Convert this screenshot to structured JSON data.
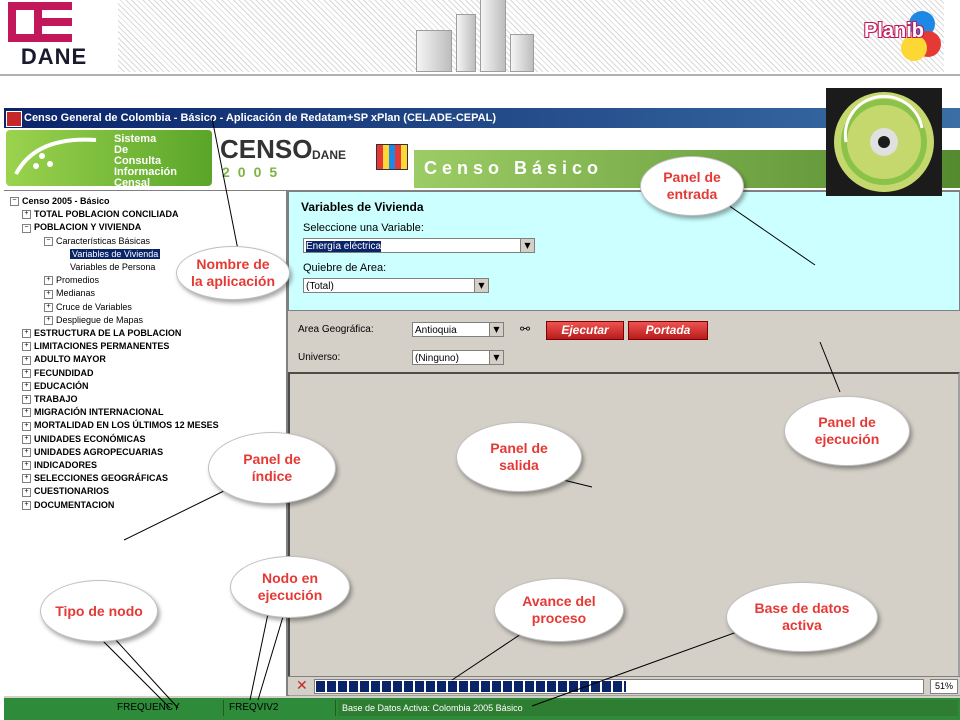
{
  "slide": {
    "dane_logo_text": "DANE",
    "planib_text": "Planib"
  },
  "app": {
    "window_title": "Censo General de Colombia - Básico - Aplicación de Redatam+SP xPlan (CELADE-CEPAL)",
    "banner": {
      "sistema_lines": "Sistema\nDe\nConsulta\nInformación\nCensal",
      "censo_text": "CENSO",
      "censo_year": "2005",
      "dane_text": "DANE",
      "censo_basico": "Censo Básico"
    },
    "tree": {
      "items": [
        {
          "label": "Censo 2005 - Básico",
          "level": 0,
          "expander": "−",
          "bold": true
        },
        {
          "label": "TOTAL POBLACION CONCILIADA",
          "level": 1,
          "expander": "+",
          "bold": true
        },
        {
          "label": "POBLACION Y VIVIENDA",
          "level": 1,
          "expander": "−",
          "bold": true
        },
        {
          "label": "Características Básicas",
          "level": 2,
          "expander": "−",
          "bold": false
        },
        {
          "label": "Variables de Vivienda",
          "level": 3,
          "expander": "",
          "bold": false,
          "selected": true
        },
        {
          "label": "Variables de Persona",
          "level": 3,
          "expander": "",
          "bold": false
        },
        {
          "label": "Promedios",
          "level": 2,
          "expander": "+",
          "bold": false
        },
        {
          "label": "Medianas",
          "level": 2,
          "expander": "+",
          "bold": false
        },
        {
          "label": "Cruce de Variables",
          "level": 2,
          "expander": "+",
          "bold": false
        },
        {
          "label": "Despliegue de Mapas",
          "level": 2,
          "expander": "+",
          "bold": false
        },
        {
          "label": "ESTRUCTURA DE LA POBLACION",
          "level": 1,
          "expander": "+",
          "bold": true
        },
        {
          "label": "LIMITACIONES PERMANENTES",
          "level": 1,
          "expander": "+",
          "bold": true
        },
        {
          "label": "ADULTO MAYOR",
          "level": 1,
          "expander": "+",
          "bold": true
        },
        {
          "label": "FECUNDIDAD",
          "level": 1,
          "expander": "+",
          "bold": true
        },
        {
          "label": "EDUCACIÓN",
          "level": 1,
          "expander": "+",
          "bold": true
        },
        {
          "label": "TRABAJO",
          "level": 1,
          "expander": "+",
          "bold": true
        },
        {
          "label": "MIGRACIÓN INTERNACIONAL",
          "level": 1,
          "expander": "+",
          "bold": true
        },
        {
          "label": "MORTALIDAD EN LOS ÚLTIMOS 12 MESES",
          "level": 1,
          "expander": "+",
          "bold": true
        },
        {
          "label": "UNIDADES ECONÓMICAS",
          "level": 1,
          "expander": "+",
          "bold": true
        },
        {
          "label": "UNIDADES AGROPECUARIAS",
          "level": 1,
          "expander": "+",
          "bold": true
        },
        {
          "label": "INDICADORES",
          "level": 1,
          "expander": "+",
          "bold": true
        },
        {
          "label": "SELECCIONES GEOGRÁFICAS",
          "level": 1,
          "expander": "+",
          "bold": true
        },
        {
          "label": "CUESTIONARIOS",
          "level": 1,
          "expander": "+",
          "bold": true
        },
        {
          "label": "DOCUMENTACION",
          "level": 1,
          "expander": "+",
          "bold": true
        }
      ]
    },
    "input_panel": {
      "title": "Variables de Vivienda",
      "variable_label": "Seleccione una Variable:",
      "variable_value": "Energía eléctrica",
      "area_label": "Quiebre de Area:",
      "area_value": "(Total)"
    },
    "exec_panel": {
      "geo_label": "Area Geográfica:",
      "geo_value": "Antioquia",
      "universe_label": "Universo:",
      "universe_value": "(Ninguno)",
      "run_button": "Ejecutar",
      "cover_button": "Portada"
    },
    "progress": {
      "value": 0.51,
      "percent_text": "51%"
    },
    "status": {
      "node_type": "FREQUENCY",
      "node_running": "FREQVIV2",
      "db_active": "Base de Datos Activa: Colombia 2005 Básico"
    }
  },
  "callouts": {
    "nombre": "Nombre de\nla aplicación",
    "entrada": "Panel de\nentrada",
    "ejecucion": "Panel de\nejecución",
    "salida": "Panel de\nsalida",
    "indice": "Panel de\níndice",
    "nodo": "Nodo en\nejecución",
    "tipo": "Tipo de nodo",
    "avance": "Avance del\nproceso",
    "base": "Base de datos\nactiva"
  },
  "colors": {
    "callout_text": "#e53935",
    "input_panel_bg": "#ccffff",
    "statusbar_bg": "#2e8b3a",
    "progress_fill": "#0a246a"
  }
}
